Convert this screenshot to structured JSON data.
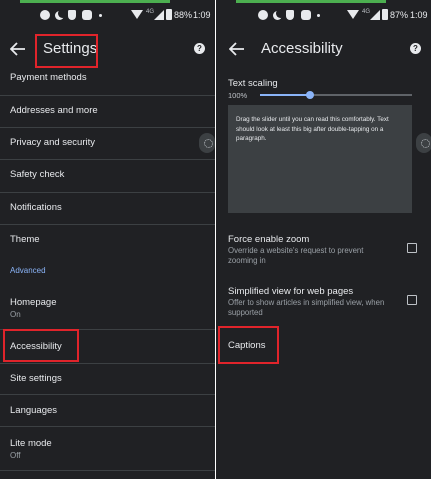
{
  "status_bar": {
    "network_label": "4G",
    "battery_left": "88%",
    "time_left": "1:09",
    "battery_right": "87%",
    "time_right": "1:09"
  },
  "left": {
    "title": "Settings",
    "items": [
      {
        "label": "Payment methods"
      },
      {
        "label": "Addresses and more"
      },
      {
        "label": "Privacy and security"
      },
      {
        "label": "Safety check"
      },
      {
        "label": "Notifications"
      },
      {
        "label": "Theme"
      }
    ],
    "section_header": "Advanced",
    "homepage": {
      "label": "Homepage",
      "sub": "On"
    },
    "accessibility": {
      "label": "Accessibility"
    },
    "site_settings": {
      "label": "Site settings"
    },
    "languages": {
      "label": "Languages"
    },
    "lite_mode": {
      "label": "Lite mode",
      "sub": "Off"
    }
  },
  "right": {
    "title": "Accessibility",
    "text_scaling": {
      "label": "Text scaling",
      "value": "100%",
      "slider_fraction": 0.33
    },
    "preview_text": "Drag the slider until you can read this comfortably. Text should look at least this big after double-tapping on a paragraph.",
    "force_zoom": {
      "title": "Force enable zoom",
      "desc": "Override a website's request to prevent zooming in",
      "checked": false
    },
    "simplified": {
      "title": "Simplified view for web pages",
      "desc": "Offer to show articles in simplified view, when supported",
      "checked": false
    },
    "captions": "Captions"
  },
  "colors": {
    "background": "#202124",
    "text": "#e8eaed",
    "secondary": "#9aa0a6",
    "accent": "#8ab4f8",
    "highlight": "#e0242b",
    "divider": "#3c4043"
  }
}
